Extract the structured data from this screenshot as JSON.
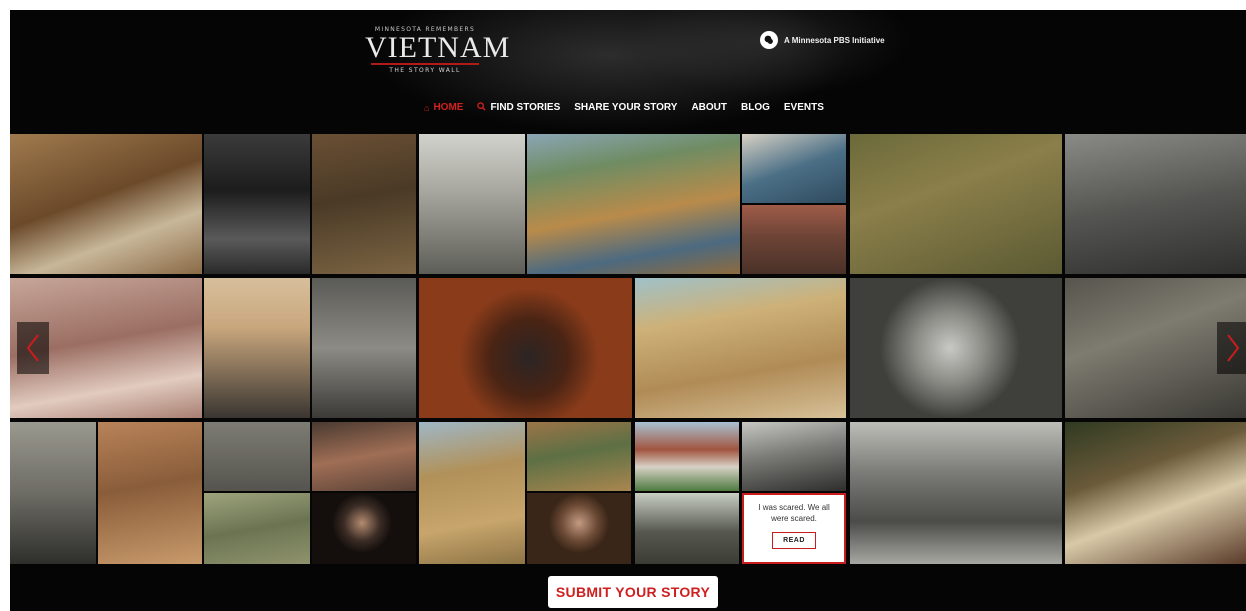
{
  "logo": {
    "subtitle": "MINNESOTA REMEMBERS",
    "title": "VIETNAM",
    "tagline": "THE STORY WALL"
  },
  "pbs": {
    "text": "A Minnesota PBS Initiative",
    "icon": "pbs-icon"
  },
  "nav": {
    "items": [
      {
        "label": "HOME",
        "icon": "home-icon",
        "active": true
      },
      {
        "label": "FIND STORIES",
        "icon": "search-icon",
        "active": false
      },
      {
        "label": "SHARE YOUR STORY",
        "active": false
      },
      {
        "label": "ABOUT",
        "active": false
      },
      {
        "label": "BLOG",
        "active": false
      },
      {
        "label": "EVENTS",
        "active": false
      }
    ]
  },
  "story_card": {
    "quote": "I was scared. We all were scared.",
    "read_label": "READ"
  },
  "submit": {
    "label": "SUBMIT YOUR STORY"
  },
  "colors": {
    "accent": "#d2211e",
    "background": "#060606"
  }
}
